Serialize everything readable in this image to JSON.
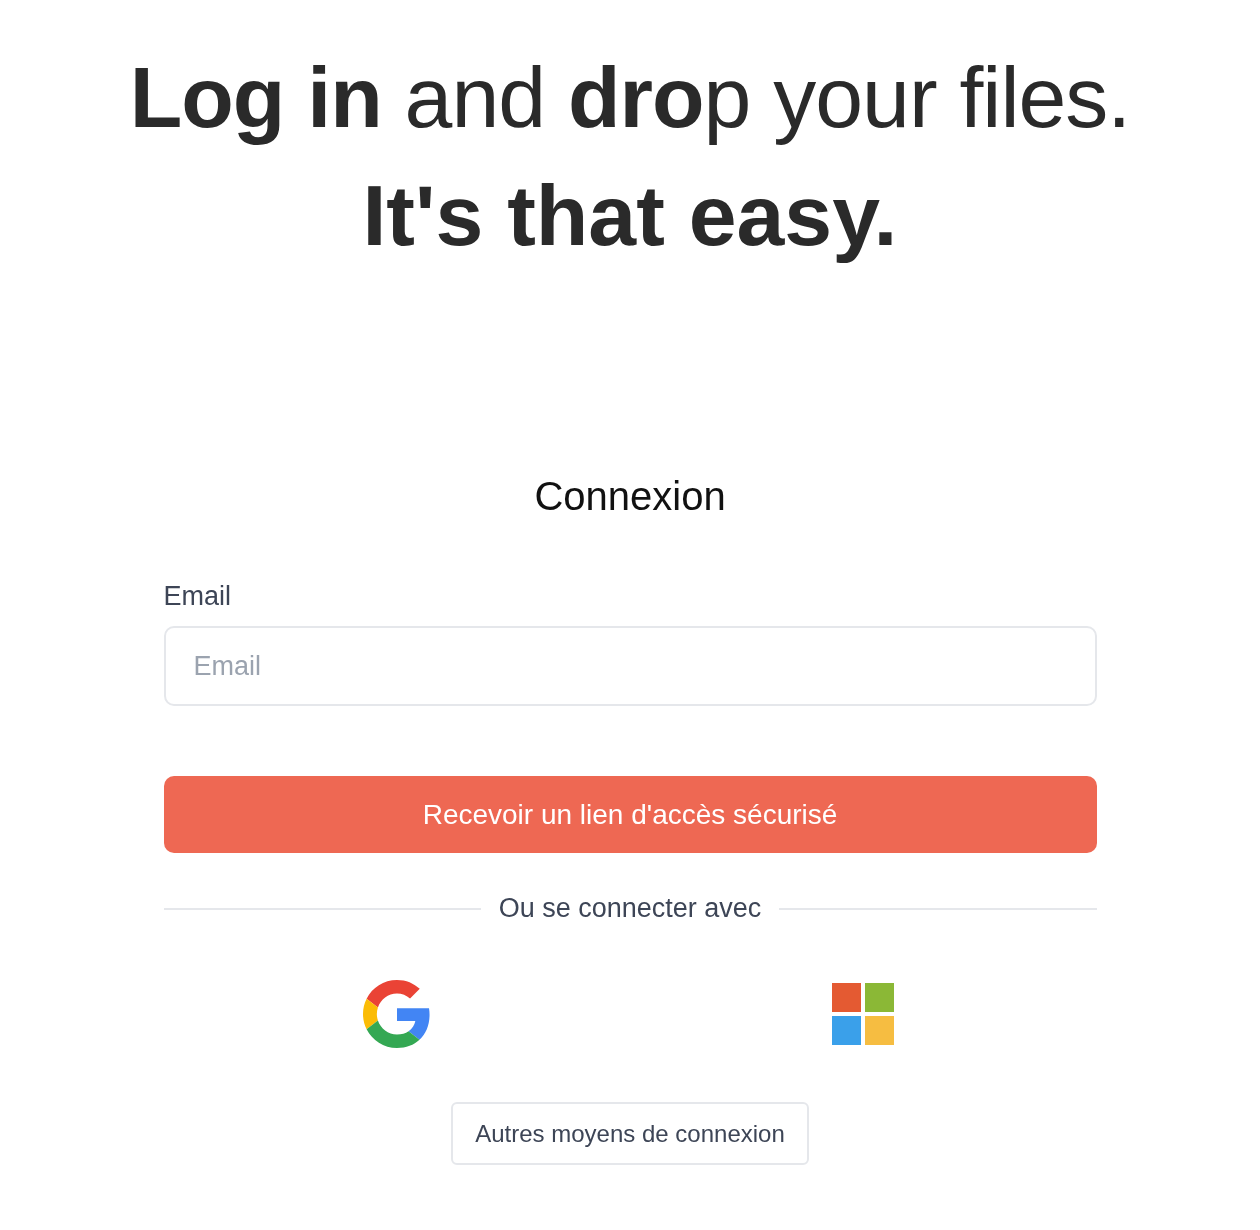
{
  "headline": {
    "line_1": "**Log in** and **dro**p your files.",
    "line_2": "It's that easy."
  },
  "login": {
    "title": "Connexion",
    "email_label": "Email",
    "email_placeholder": "Email",
    "submit_button": "Recevoir un lien d'accès sécurisé",
    "divider_text": "Ou se connecter avec",
    "other_button": "Autres moyens de connexion"
  }
}
